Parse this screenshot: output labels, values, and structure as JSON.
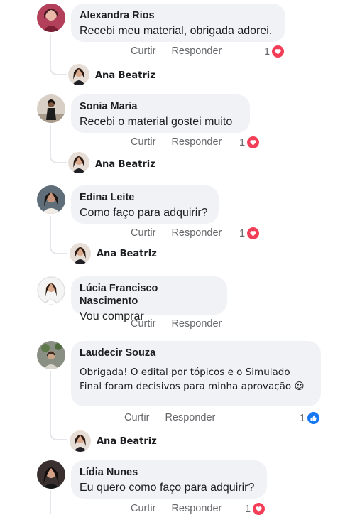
{
  "actions": {
    "like_label": "Curtir",
    "reply_label": "Responder"
  },
  "comments": [
    {
      "name": "Alexandra Rios",
      "text": "Recebi meu material, obrigada adorei.",
      "reaction": "heart",
      "count": "1",
      "reply_author": "Ana Beatriz"
    },
    {
      "name": "Sonia Maria",
      "text": "Recebi o  material gostei muito",
      "reaction": "heart",
      "count": "1",
      "reply_author": "Ana Beatriz"
    },
    {
      "name": "Edina Leite",
      "text": "Como faço para adquirir?",
      "reaction": "heart",
      "count": "1",
      "reply_author": "Ana Beatriz"
    },
    {
      "name": "Lúcia Francisco Nascimento",
      "text": "Vou comprar"
    },
    {
      "name": "Laudecir Souza",
      "text": "Obrigada! O edital por tópicos e o Simulado Final foram decisivos para minha aprovação",
      "emoji": "😍",
      "reaction": "like",
      "count": "1",
      "reply_author": "Ana Beatriz"
    },
    {
      "name": "Lídia Nunes",
      "text": "Eu quero como faço para adquirir?",
      "reaction": "heart",
      "count": "1"
    }
  ],
  "colors": {
    "bubble": "#f0f2f5",
    "heart": "#f33e58",
    "like": "#1877f2",
    "meta": "#65676b"
  }
}
